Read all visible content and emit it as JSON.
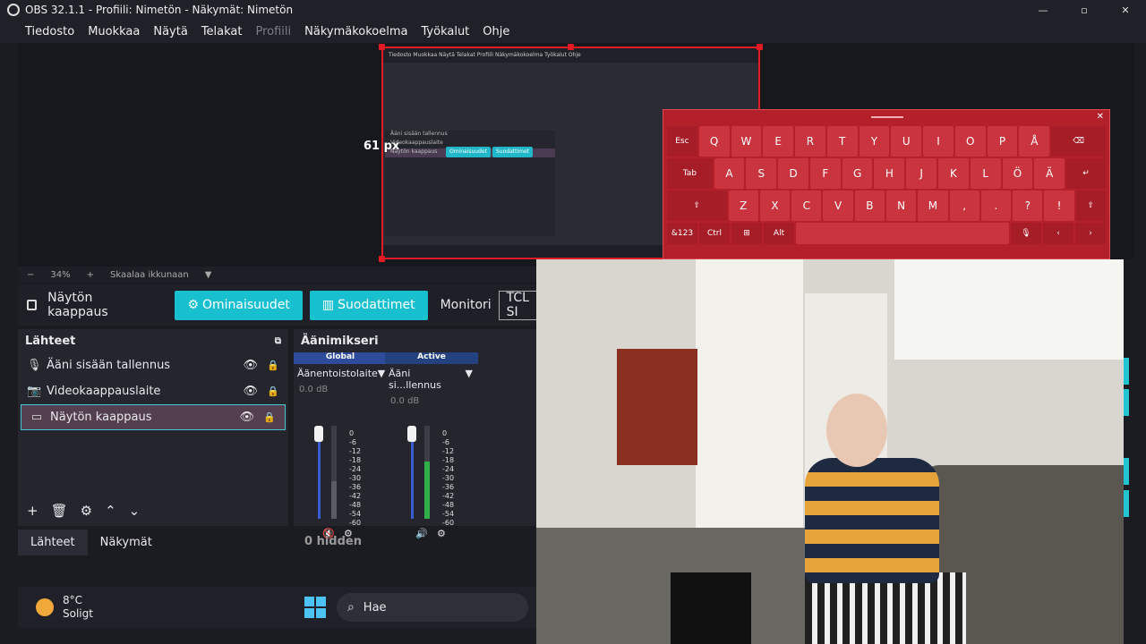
{
  "window": {
    "title": "OBS 32.1.1 - Profiili: Nimetön - Näkymät: Nimetön",
    "minimize": "—",
    "maximize": "▫",
    "close": "✕"
  },
  "menu": {
    "items": [
      "Tiedosto",
      "Muokkaa",
      "Näytä",
      "Telakat",
      "Profiili",
      "Näkymäkokoelma",
      "Työkalut",
      "Ohje"
    ]
  },
  "preview": {
    "offset_label": "61 px",
    "zoom": "34%",
    "scale_mode": "Skaalaa ikkunaan",
    "nested_menu": "Tiedosto  Muokkaa  Näytä  Telakat  Profiili  Näkymäkokoelma  Työkalut  Ohje",
    "nested_sources": [
      "Ääni sisään tallennus",
      "Videokaappauslaite",
      "Näytön kaappaus"
    ],
    "nested_buttons": [
      "Ominaisuudet",
      "Suodattimet"
    ]
  },
  "keyboard": {
    "row1": [
      "Esc",
      "Q",
      "W",
      "E",
      "R",
      "T",
      "Y",
      "U",
      "I",
      "O",
      "P",
      "Å",
      "⌫"
    ],
    "row2": [
      "Tab",
      "A",
      "S",
      "D",
      "F",
      "G",
      "H",
      "J",
      "K",
      "L",
      "Ö",
      "Ä",
      "↵"
    ],
    "row3": [
      "⇧",
      "Z",
      "X",
      "C",
      "V",
      "B",
      "N",
      "M",
      ",",
      ".",
      "?",
      "!",
      "⇧"
    ],
    "row4": [
      "&123",
      "Ctrl",
      "⊞",
      "Alt",
      "",
      "🎙",
      "‹",
      "›"
    ]
  },
  "source_toolbar": {
    "source_name": "Näytön kaappaus",
    "properties_label": "Ominaisuudet",
    "filters_label": "Suodattimet",
    "monitor_label": "Monitori",
    "monitor_value": "TCL SI"
  },
  "sources": {
    "title": "Lähteet",
    "items": [
      {
        "label": "Ääni sisään tallennus",
        "icon": "microphone-icon"
      },
      {
        "label": "Videokaappauslaite",
        "icon": "camera-icon"
      },
      {
        "label": "Näytön kaappaus",
        "icon": "monitor-icon"
      }
    ]
  },
  "mixer": {
    "title": "Äänimikseri",
    "channels": [
      {
        "tag": "Global",
        "device": "Äänentoistolaite",
        "db": "0.0 dB"
      },
      {
        "tag": "Active",
        "device": "Ääni si...llennus",
        "db": "0.0 dB"
      }
    ],
    "scale": [
      "0",
      "-6",
      "-12",
      "-18",
      "-24",
      "-30",
      "-36",
      "-42",
      "-48",
      "-54",
      "-60"
    ],
    "hidden": "0 hidden"
  },
  "tabs": [
    "Lähteet",
    "Näkymät"
  ],
  "taskbar": {
    "temperature": "8°C",
    "weather": "Soligt",
    "search_placeholder": "Hae"
  },
  "colors": {
    "accent": "#18c0cf",
    "selection_border": "#e01b24",
    "keyboard_bg": "#b3202a"
  }
}
